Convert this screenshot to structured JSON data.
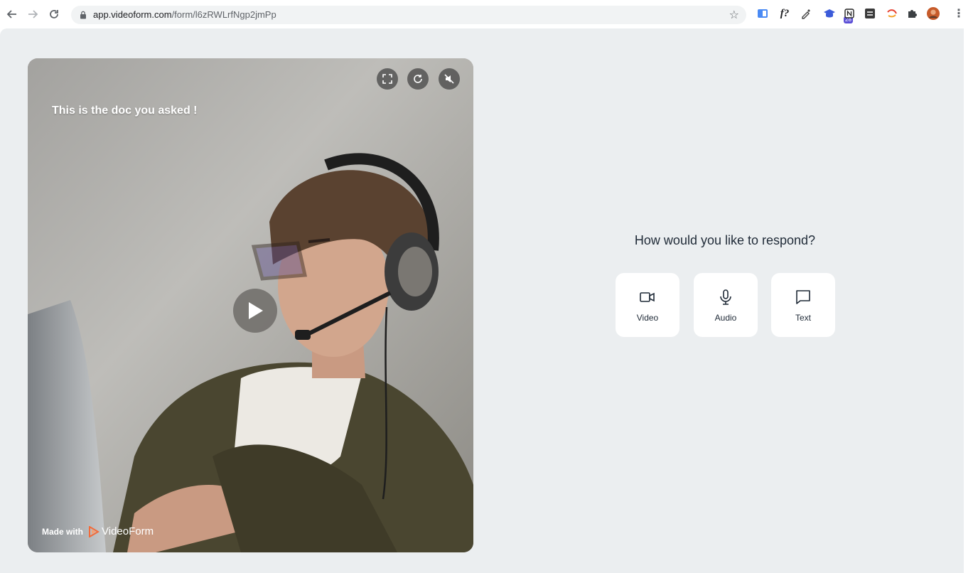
{
  "browser": {
    "url_host": "app.videoform.com",
    "url_path": "/form/l6zRWLrfNgp2jmPp",
    "extension_badge": "28",
    "extensions": [
      "translate-icon",
      "fx-icon",
      "eyedropper-icon",
      "graduation-cap-icon",
      "notion-icon",
      "selenium-icon",
      "lens-icon",
      "puzzle-icon",
      "profile-avatar"
    ]
  },
  "video": {
    "title": "This is the doc you asked !",
    "made_with_label": "Made with",
    "brand": "VideoForm",
    "controls": [
      "fullscreen-icon",
      "refresh-icon",
      "mute-icon"
    ]
  },
  "respond": {
    "title": "How would you like to respond?",
    "options": [
      {
        "label": "Video",
        "icon": "video-camera-icon"
      },
      {
        "label": "Audio",
        "icon": "microphone-icon"
      },
      {
        "label": "Text",
        "icon": "chat-bubble-icon"
      }
    ]
  },
  "colors": {
    "page_bg": "#ebeef0",
    "brand_accent": "#f26b3a",
    "text_dark": "#1f2a37"
  }
}
